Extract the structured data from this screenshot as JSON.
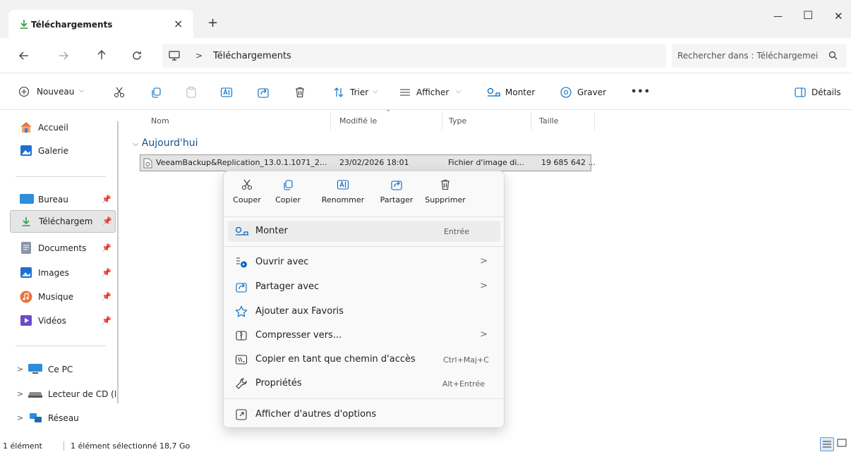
{
  "window": {
    "tab_title": "Téléchargements",
    "tab_close": "×",
    "new_tab": "+",
    "minimize": "—",
    "maximize": "☐",
    "close": "✕"
  },
  "address": {
    "breadcrumb_sep": ">",
    "location": "Téléchargements",
    "search_placeholder": "Rechercher dans : Téléchargemei"
  },
  "toolbar": {
    "new_label": "Nouveau",
    "sort_label": "Trier",
    "view_label": "Afficher",
    "mount_label": "Monter",
    "burn_label": "Graver",
    "more_label": "•••",
    "details_label": "Détails"
  },
  "sidebar": {
    "top": [
      {
        "label": "Accueil",
        "icon": "home-icon"
      },
      {
        "label": "Galerie",
        "icon": "gallery-icon"
      }
    ],
    "pinned": [
      {
        "label": "Bureau",
        "icon": "desktop-icon"
      },
      {
        "label": "Téléchargem",
        "icon": "download-icon"
      },
      {
        "label": "Documents",
        "icon": "documents-icon"
      },
      {
        "label": "Images",
        "icon": "images-icon"
      },
      {
        "label": "Musique",
        "icon": "music-icon"
      },
      {
        "label": "Vidéos",
        "icon": "videos-icon"
      }
    ],
    "drives": [
      {
        "label": "Ce PC",
        "icon": "pc-icon"
      },
      {
        "label": "Lecteur de CD (I",
        "icon": "cd-drive-icon"
      },
      {
        "label": "Réseau",
        "icon": "network-icon"
      }
    ]
  },
  "columns": {
    "name": "Nom",
    "modified": "Modifié le",
    "type": "Type",
    "size": "Taille"
  },
  "group": {
    "label": "Aujourd'hui"
  },
  "file": {
    "name": "VeeamBackup&Replication_13.0.1.1071_2...",
    "modified": "23/02/2026 18:01",
    "type": "Fichier d'image di...",
    "size": "19 685 642 ..."
  },
  "context_menu": {
    "quick_actions": [
      {
        "label": "Couper",
        "icon": "cut-icon"
      },
      {
        "label": "Copier",
        "icon": "copy-icon"
      },
      {
        "label": "Renommer",
        "icon": "rename-icon"
      },
      {
        "label": "Partager",
        "icon": "share-icon"
      },
      {
        "label": "Supprimer",
        "icon": "delete-icon"
      }
    ],
    "items": [
      {
        "label": "Monter",
        "shortcut": "Entrée"
      },
      {
        "label": "Ouvrir avec",
        "submenu": ">"
      },
      {
        "label": "Partager avec",
        "submenu": ">"
      },
      {
        "label": "Ajouter aux Favoris"
      },
      {
        "label": "Compresser vers...",
        "submenu": ">"
      },
      {
        "label": "Copier en tant que chemin d'accès",
        "shortcut": "Ctrl+Maj+C"
      },
      {
        "label": "Propriétés",
        "shortcut": "Alt+Entrée"
      },
      {
        "label": "Afficher d'autres d'options"
      }
    ]
  },
  "status": {
    "count": "1 élément",
    "selection": "1 élément sélectionné 18,7 Go"
  },
  "colors": {
    "accent": "#0067c0",
    "download_green": "#2e9e3f",
    "selection_bg": "#e4e4e4",
    "menu_bg": "#f9f9f9"
  }
}
